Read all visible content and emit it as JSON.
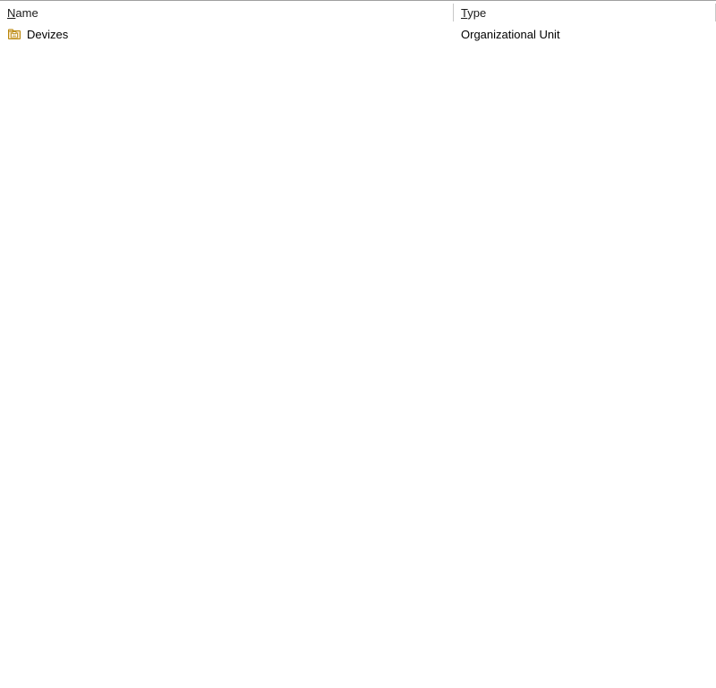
{
  "columns": {
    "name": {
      "label": "Name",
      "accel": "N",
      "rest": "ame"
    },
    "type": {
      "label": "Type",
      "accel": "T",
      "rest": "ype"
    }
  },
  "rows": [
    {
      "icon": "ou-folder-icon",
      "name": "Devizes",
      "type": "Organizational Unit"
    }
  ]
}
